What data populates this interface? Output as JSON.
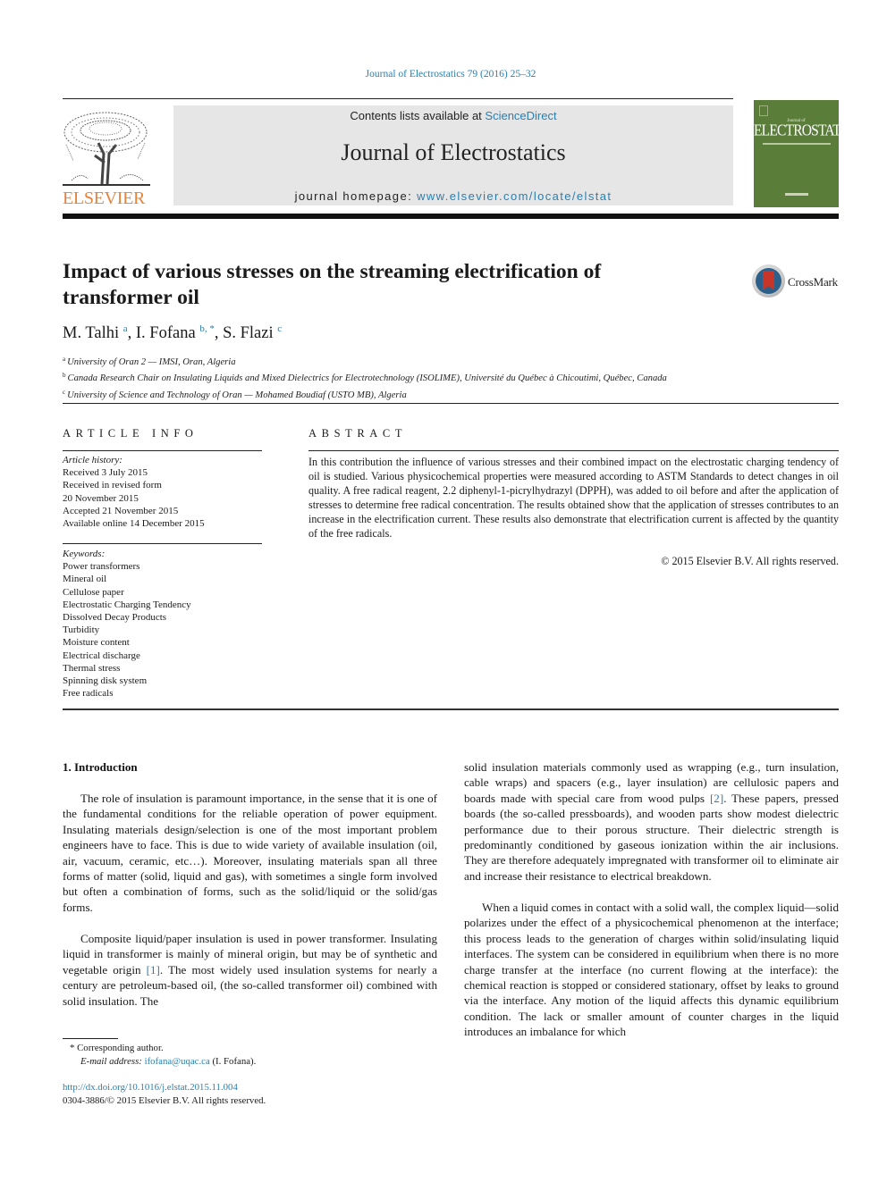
{
  "header": {
    "journal_ref": "Journal of Electrostatics 79 (2016) 25–32",
    "publisher_logo_text": "ELSEVIER",
    "contents_prefix": "Contents lists available at ",
    "contents_link": "ScienceDirect",
    "journal_title": "Journal of Electrostatics",
    "homepage_prefix": "journal homepage: ",
    "homepage_link": "www.elsevier.com/locate/elstat",
    "cover": {
      "small_text": "Journal of",
      "title": "ELECTROSTATICS",
      "color": "#5a7d3a"
    }
  },
  "article": {
    "title": "Impact of various stresses on the streaming electrification of transformer oil",
    "crossmark_label": "CrossMark",
    "authors": [
      {
        "name": "M. Talhi",
        "sup": "a"
      },
      {
        "name": "I. Fofana",
        "sup": "b, *"
      },
      {
        "name": "S. Flazi",
        "sup": "c"
      }
    ],
    "affiliations": [
      {
        "sup": "a",
        "text": "University of Oran 2 — IMSI, Oran, Algeria"
      },
      {
        "sup": "b",
        "text": "Canada Research Chair on Insulating Liquids and Mixed Dielectrics for Electrotechnology (ISOLIME), Université du Québec à Chicoutimi, Québec, Canada"
      },
      {
        "sup": "c",
        "text": "University of Science and Technology of Oran — Mohamed Boudiaf (USTO MB), Algeria"
      }
    ]
  },
  "article_info": {
    "heading": "ARTICLE INFO",
    "history_label": "Article history:",
    "history": [
      "Received 3 July 2015",
      "Received in revised form",
      "20 November 2015",
      "Accepted 21 November 2015",
      "Available online 14 December 2015"
    ],
    "keywords_label": "Keywords:",
    "keywords": [
      "Power transformers",
      "Mineral oil",
      "Cellulose paper",
      "Electrostatic Charging Tendency",
      "Dissolved Decay Products",
      "Turbidity",
      "Moisture content",
      "Electrical discharge",
      "Thermal stress",
      "Spinning disk system",
      "Free radicals"
    ]
  },
  "abstract": {
    "heading": "ABSTRACT",
    "text": "In this contribution the influence of various stresses and their combined impact on the electrostatic charging tendency of oil is studied. Various physicochemical properties were measured according to ASTM Standards to detect changes in oil quality. A free radical reagent, 2.2 diphenyl-1-picrylhydrazyl (DPPH), was added to oil before and after the application of stresses to determine free radical concentration. The results obtained show that the application of stresses contributes to an increase in the electrification current. These results also demonstrate that electrification current is affected by the quantity of the free radicals.",
    "copyright": "© 2015 Elsevier B.V. All rights reserved."
  },
  "body": {
    "section_heading": "1.  Introduction",
    "left_p1": "The role of insulation is paramount importance, in the sense that it is one of the fundamental conditions for the reliable operation of power equipment. Insulating materials design/selection is one of the most important problem engineers have to face. This is due to wide variety of available insulation (oil, air, vacuum, ceramic, etc…). Moreover, insulating materials span all three forms of matter (solid, liquid and gas), with sometimes a single form involved but often a combination of forms, such as the solid/liquid or the solid/gas forms.",
    "left_p2_a": "Composite liquid/paper insulation is used in power transformer. Insulating liquid in transformer is mainly of mineral origin, but may be of synthetic and vegetable origin ",
    "left_p2_ref": "[1]",
    "left_p2_b": ". The most widely used insulation systems for nearly a century are petroleum-based oil, (the so-called transformer oil) combined with solid insulation. The",
    "right_p1_a": "solid insulation materials commonly used as wrapping (e.g., turn insulation, cable wraps) and spacers (e.g., layer insulation) are cellulosic papers and boards made with special care from wood pulps ",
    "right_p1_ref": "[2]",
    "right_p1_b": ". These papers, pressed boards (the so-called pressboards), and wooden parts show modest dielectric performance due to their porous structure. Their dielectric strength is predominantly conditioned by gaseous ionization within the air inclusions. They are therefore adequately impregnated with transformer oil to eliminate air and increase their resistance to electrical breakdown.",
    "right_p2": "When a liquid comes in contact with a solid wall, the complex liquid—solid polarizes under the effect of a physicochemical phenomenon at the interface; this process leads to the generation of charges within solid/insulating liquid interfaces. The system can be considered in equilibrium when there is no more charge transfer at the interface (no current flowing at the interface): the chemical reaction is stopped or considered stationary, offset by leaks to ground via the interface. Any motion of the liquid affects this dynamic equilibrium condition. The lack or smaller amount of counter charges in the liquid introduces an imbalance for which"
  },
  "footer": {
    "corresponding": "* Corresponding author.",
    "email_label": "E-mail address:",
    "email": "ifofana@uqac.ca",
    "email_suffix": " (I. Fofana).",
    "doi": "http://dx.doi.org/10.1016/j.elstat.2015.11.004",
    "issn": "0304-3886/© 2015 Elsevier B.V. All rights reserved."
  }
}
